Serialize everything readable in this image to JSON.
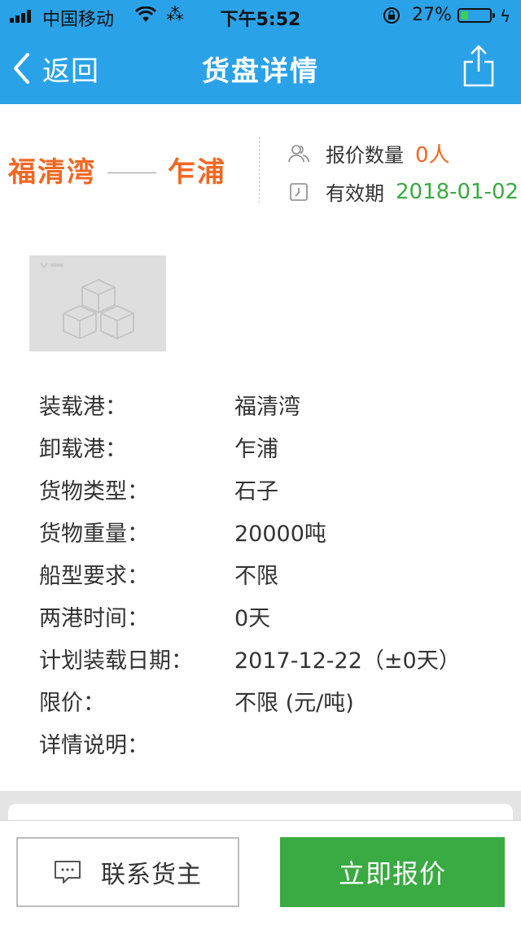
{
  "status_bar": {
    "carrier": "中国移动",
    "time": "下午5:52",
    "battery_percent": "27%",
    "battery_level": 0.27
  },
  "nav": {
    "back_label": "返回",
    "title": "货盘详情",
    "share_icon": "share-icon"
  },
  "summary": {
    "from_port": "福清湾",
    "to_port": "乍浦",
    "quote_count_label": "报价数量",
    "quote_count_value": "0人",
    "validity_label": "有效期",
    "validity_value": "2018-01-02"
  },
  "details": [
    {
      "label": "装载港：",
      "value": "福清湾"
    },
    {
      "label": "卸载港：",
      "value": "乍浦"
    },
    {
      "label": "货物类型：",
      "value": "石子"
    },
    {
      "label": "货物重量：",
      "value": "20000吨"
    },
    {
      "label": "船型要求：",
      "value": "不限"
    },
    {
      "label": "两港时间：",
      "value": "0天"
    },
    {
      "label": "计划装载日期：",
      "value": "2017-12-22（±0天）"
    },
    {
      "label": "限价：",
      "value": "不限 (元/吨)"
    },
    {
      "label": "详情说明：",
      "value": ""
    }
  ],
  "actions": {
    "contact_label": "联系货主",
    "quote_label": "立即报价"
  },
  "colors": {
    "brand_blue": "#2aa2e8",
    "accent_orange": "#f26722",
    "accent_green": "#3aaa42"
  }
}
